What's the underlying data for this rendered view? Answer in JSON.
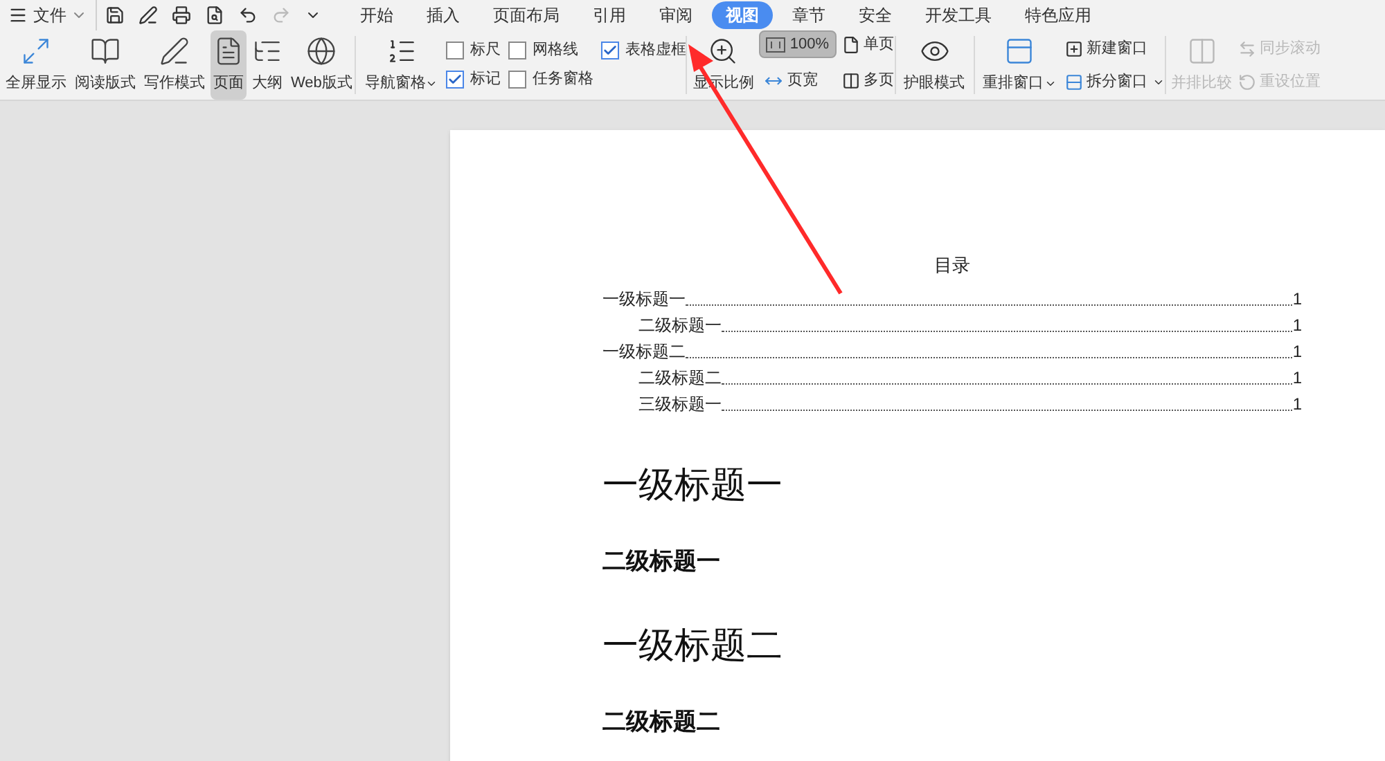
{
  "menu_bar": {
    "file_label": "文件",
    "tabs": [
      {
        "label": "开始",
        "selected": false
      },
      {
        "label": "插入",
        "selected": false
      },
      {
        "label": "页面布局",
        "selected": false
      },
      {
        "label": "引用",
        "selected": false
      },
      {
        "label": "审阅",
        "selected": false
      },
      {
        "label": "视图",
        "selected": true
      },
      {
        "label": "章节",
        "selected": false
      },
      {
        "label": "安全",
        "selected": false
      },
      {
        "label": "开发工具",
        "selected": false
      },
      {
        "label": "特色应用",
        "selected": false
      }
    ]
  },
  "ribbon": {
    "view_modes": [
      {
        "kind": "fullscreen",
        "label": "全屏显示",
        "selected": false
      },
      {
        "kind": "read",
        "label": "阅读版式",
        "selected": false
      },
      {
        "kind": "write",
        "label": "写作模式",
        "selected": false
      },
      {
        "kind": "page",
        "label": "页面",
        "selected": true
      },
      {
        "kind": "outline",
        "label": "大纲",
        "selected": false
      },
      {
        "kind": "web",
        "label": "Web版式",
        "selected": false
      }
    ],
    "nav_pane": "导航窗格",
    "checkboxes": [
      {
        "label": "标尺",
        "checked": false
      },
      {
        "label": "标记",
        "checked": true
      },
      {
        "label": "网格线",
        "checked": false
      },
      {
        "label": "任务窗格",
        "checked": false
      },
      {
        "label": "表格虚框",
        "checked": true
      }
    ],
    "zoom": {
      "label": "显示比例",
      "percent": "100%",
      "percent_selected": true,
      "page_width": "页宽",
      "single_page": "单页",
      "multi_page": "多页"
    },
    "eye_mode": "护眼模式",
    "rearrange": "重排窗口",
    "new_window": "新建窗口",
    "split_window": "拆分窗口",
    "compare": {
      "label": "并排比较",
      "disabled": true
    },
    "sync_scroll": {
      "label": "同步滚动",
      "disabled": true
    },
    "reset_position": {
      "label": "重设位置",
      "disabled": true
    }
  },
  "document": {
    "toc_title": "目录",
    "toc": [
      {
        "text": "一级标题一",
        "page": "1",
        "children": [
          {
            "text": "二级标题一",
            "page": "1"
          }
        ]
      },
      {
        "text": "一级标题二",
        "page": "1",
        "children": [
          {
            "text": "二级标题二",
            "page": "1"
          },
          {
            "text": "三级标题一",
            "page": "1"
          }
        ]
      }
    ],
    "headings": [
      {
        "kind": "h1",
        "text": "一级标题一"
      },
      {
        "kind": "h2",
        "text": "二级标题一"
      },
      {
        "kind": "h1",
        "text": "一级标题二"
      },
      {
        "kind": "h2",
        "text": "二级标题二"
      }
    ]
  }
}
